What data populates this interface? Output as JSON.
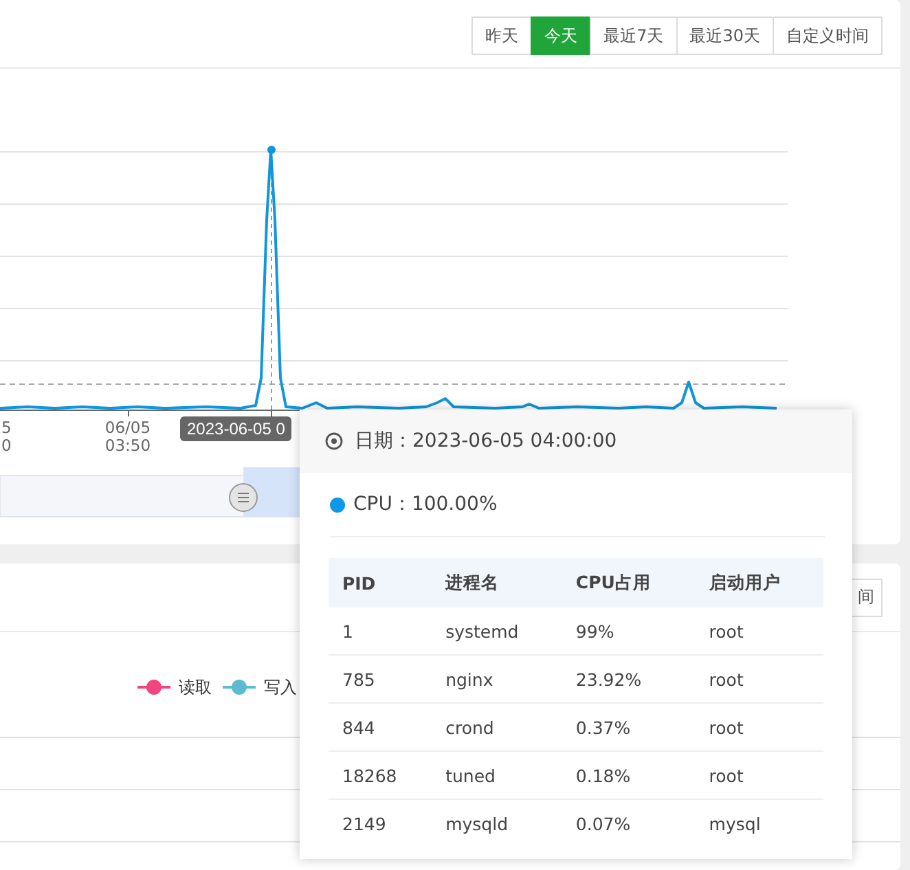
{
  "cpu_panel": {
    "range_buttons": [
      {
        "label": "昨天",
        "selected": false
      },
      {
        "label": "今天",
        "selected": true
      },
      {
        "label": "最近7天",
        "selected": false
      },
      {
        "label": "最近30天",
        "selected": false
      },
      {
        "label": "自定义时间",
        "selected": false
      }
    ],
    "axis_labels": [
      {
        "text": "5\n0"
      },
      {
        "text": "06/05\n03:50"
      }
    ],
    "pointer_label": "2023-06-05 0"
  },
  "disk_panel": {
    "button_fragment": "间",
    "legend": [
      {
        "label": "读取",
        "color": "#f2457e"
      },
      {
        "label": "写入",
        "color": "#5bbcd0"
      }
    ]
  },
  "tooltip": {
    "date": "日期：2023-06-05 04:00:00",
    "series": [
      {
        "label": "CPU：100.00%",
        "color": "#0e98e8"
      }
    ],
    "columns": [
      "PID",
      "进程名",
      "CPU占用",
      "启动用户"
    ],
    "rows": [
      [
        "1",
        "systemd",
        "99%",
        "root"
      ],
      [
        "785",
        "nginx",
        "23.92%",
        "root"
      ],
      [
        "844",
        "crond",
        "0.37%",
        "root"
      ],
      [
        "18268",
        "tuned",
        "0.18%",
        "root"
      ],
      [
        "2149",
        "mysqld",
        "0.07%",
        "mysql"
      ]
    ]
  }
}
